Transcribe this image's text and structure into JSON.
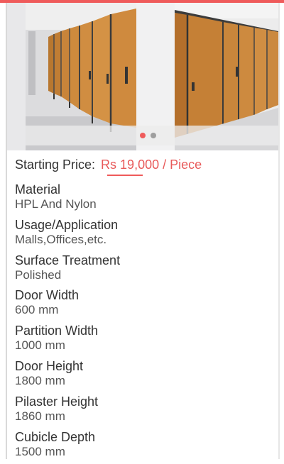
{
  "colors": {
    "accent": "#ef5b5b",
    "price": "#e85a5a"
  },
  "gallery": {
    "images": [
      {
        "name": "toilet-cubicle-partition-photo-1",
        "alt": ""
      },
      {
        "name": "toilet-cubicle-partition-photo-2",
        "alt": ""
      }
    ],
    "active_index": 0,
    "dot_count": 2
  },
  "price": {
    "label": "Starting Price:",
    "value": "Rs 19,000 / Piece"
  },
  "specs": [
    {
      "label": "Material",
      "value": "HPL And Nylon"
    },
    {
      "label": "Usage/Application",
      "value": "Malls,Offices,etc."
    },
    {
      "label": "Surface Treatment",
      "value": "Polished"
    },
    {
      "label": "Door Width",
      "value": "600 mm"
    },
    {
      "label": "Partition Width",
      "value": "1000 mm"
    },
    {
      "label": "Door Height",
      "value": "1800 mm"
    },
    {
      "label": "Pilaster Height",
      "value": "1860 mm"
    },
    {
      "label": "Cubicle Depth",
      "value": "1500 mm"
    }
  ]
}
